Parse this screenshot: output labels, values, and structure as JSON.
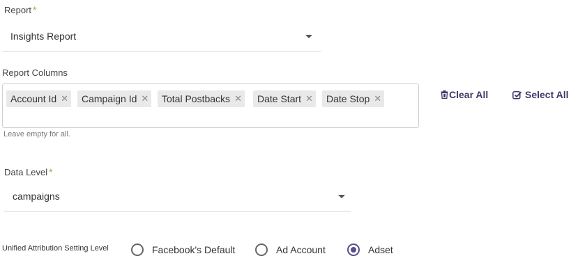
{
  "report": {
    "label": "Report",
    "required_mark": "*",
    "value": "Insights Report"
  },
  "columns": {
    "label": "Report Columns",
    "chips": [
      "Account Id",
      "Campaign Id",
      "Total Postbacks",
      "Date Start",
      "Date Stop"
    ],
    "remove_glyph": "✕",
    "hint": "Leave empty for all.",
    "clear_all_label": "Clear All",
    "select_all_label": "Select All"
  },
  "data_level": {
    "label": "Data Level",
    "required_mark": "*",
    "value": "campaigns"
  },
  "attribution": {
    "label": "Unified Attribution Setting Level",
    "options": [
      "Facebook's Default",
      "Ad Account",
      "Adset"
    ],
    "selected": "Adset"
  },
  "colors": {
    "accent": "#5a4e8c",
    "required": "#7cb342",
    "chip_bg": "#e9e9e9"
  },
  "icons": {
    "clear_all": "trash-icon",
    "select_all": "check-square-icon",
    "dropdown": "caret-down-icon"
  }
}
